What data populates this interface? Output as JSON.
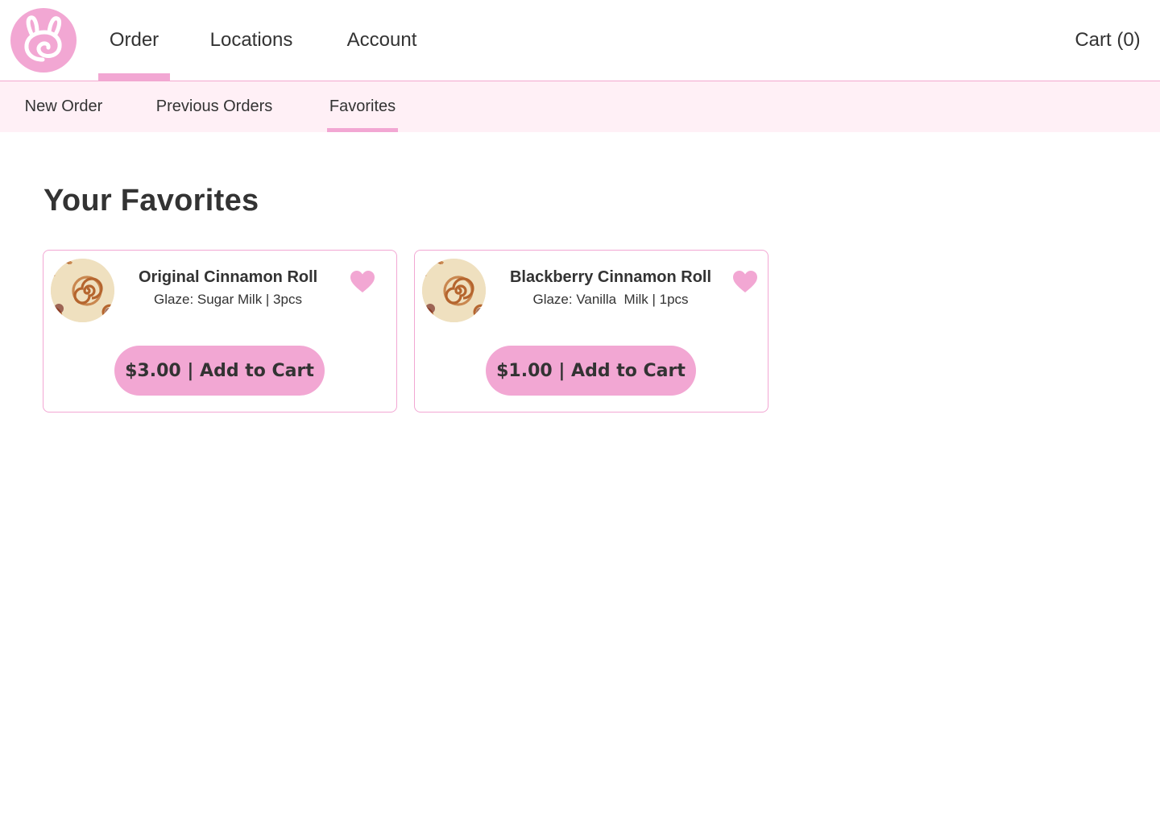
{
  "header": {
    "logo_icon": "bunny-swirl-icon",
    "nav": {
      "order": "Order",
      "locations": "Locations",
      "account": "Account",
      "cart": "Cart (0)"
    }
  },
  "subnav": {
    "new_order": "New Order",
    "previous_orders": "Previous Orders",
    "favorites": "Favorites"
  },
  "main": {
    "title": "Your Favorites",
    "favorites": [
      {
        "name": "Original Cinnamon Roll",
        "details": "Glaze: Sugar Milk | 3pcs",
        "button": "$3.00 | Add to Cart",
        "icon": "heart-icon"
      },
      {
        "name": "Blackberry Cinnamon Roll",
        "details": "Glaze: Vanilla  Milk | 1pcs",
        "button": "$1.00 | Add to Cart",
        "icon": "heart-icon"
      }
    ]
  },
  "colors": {
    "accent": "#f2a7d3",
    "subnav_bg": "#fff0f6",
    "text": "#333333"
  }
}
